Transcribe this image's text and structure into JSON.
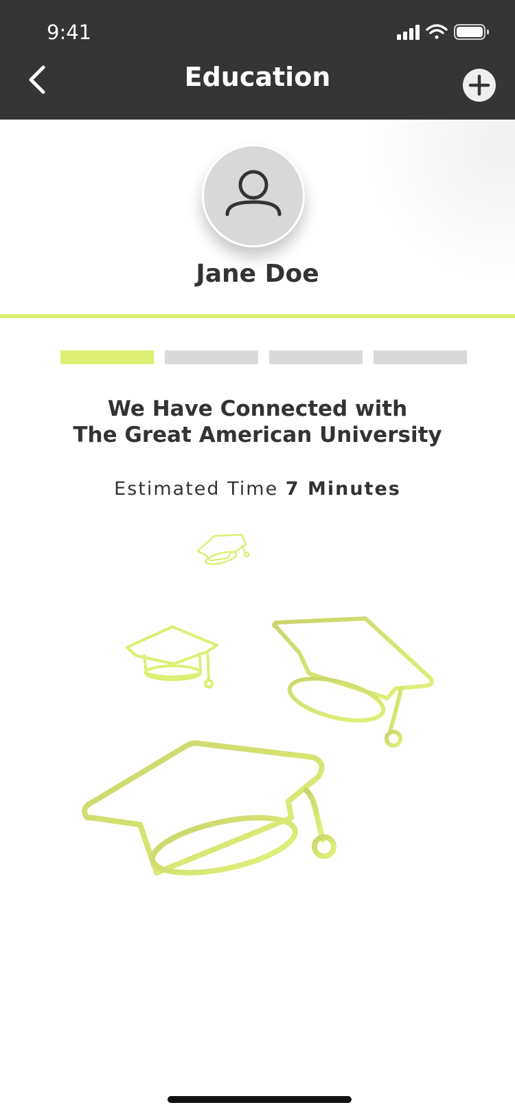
{
  "status_bar": {
    "time": "9:41",
    "icons": [
      "cellular-signal-icon",
      "wifi-icon",
      "battery-icon"
    ]
  },
  "nav": {
    "title": "Education",
    "back_icon": "chevron-left-icon",
    "add_icon": "plus-circle-icon"
  },
  "profile": {
    "name": "Jane Doe",
    "avatar_icon": "user-icon"
  },
  "progress": {
    "total_steps": 4,
    "current_step": 1,
    "active_color": "#dcef72",
    "inactive_color": "#d9d9d9"
  },
  "content": {
    "heading_line1": "We Have Connected with",
    "heading_line2": "The Great American University",
    "estimate_prefix": "Estimated Time",
    "estimate_value": "7 Minutes"
  },
  "illustration": {
    "icon": "graduation-cap-icon",
    "count": 4,
    "accent_color": "#dcef72"
  },
  "colors": {
    "header_bg": "#353535",
    "accent": "#dcef72",
    "text": "#333333"
  }
}
